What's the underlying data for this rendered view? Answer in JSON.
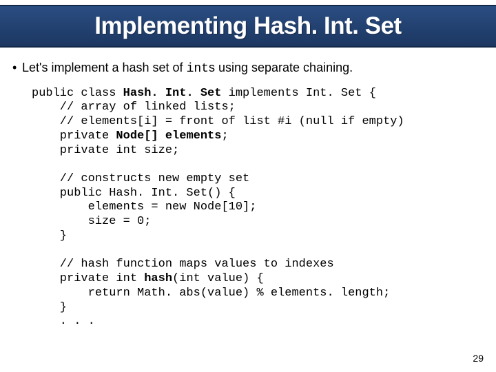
{
  "title": "Implementing Hash. Int. Set",
  "bullet": {
    "dot": "•",
    "pre": "Let's implement a hash set of ",
    "mono": "int",
    "post": "s using separate chaining."
  },
  "code": {
    "l1a": "public class ",
    "l1b": "Hash. Int. Set",
    "l1c": " implements Int. Set {",
    "l2": "    // array of linked lists;",
    "l3": "    // elements[i] = front of list #i (null if empty)",
    "l4a": "    private ",
    "l4b": "Node[] elements",
    "l4c": ";",
    "l5": "    private int size;",
    "blank1": " ",
    "l6": "    // constructs new empty set",
    "l7": "    public Hash. Int. Set() {",
    "l8": "        elements = new Node[10];",
    "l9": "        size = 0;",
    "l10": "    }",
    "blank2": " ",
    "l11": "    // hash function maps values to indexes",
    "l12a": "    private int ",
    "l12b": "hash",
    "l12c": "(int value) {",
    "l13": "        return Math. abs(value) % elements. length;",
    "l14": "    }",
    "l15": "    . . ."
  },
  "page_number": "29"
}
